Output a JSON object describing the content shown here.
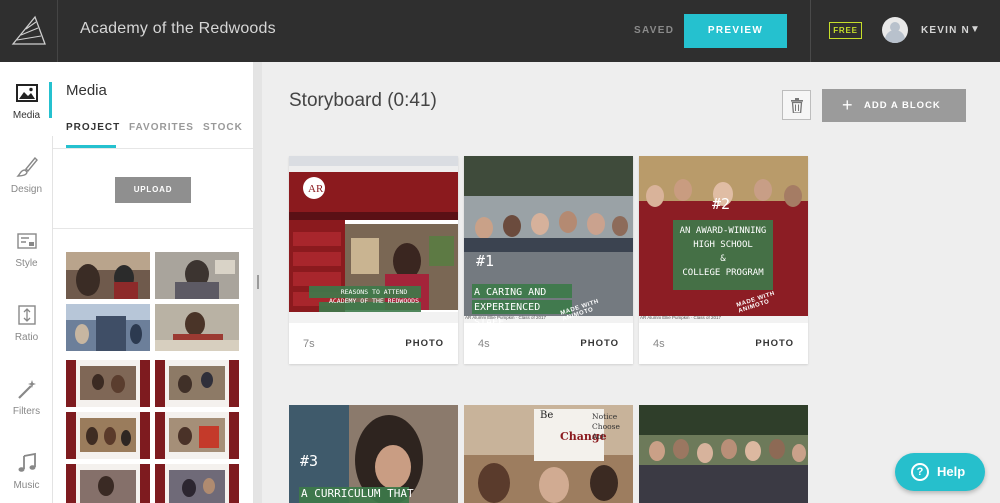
{
  "app": {
    "title": "Academy of the Redwoods",
    "status": "SAVED",
    "preview_label": "PREVIEW",
    "plan_badge": "FREE",
    "user_name": "KEVIN N",
    "accent": "#25c1cf"
  },
  "rail": {
    "items": [
      {
        "label": "Media",
        "icon": "image-icon",
        "active": true
      },
      {
        "label": "Design",
        "icon": "brush-icon"
      },
      {
        "label": "Style",
        "icon": "style-icon"
      },
      {
        "label": "Ratio",
        "icon": "ratio-icon"
      },
      {
        "label": "Filters",
        "icon": "magic-wand-icon"
      },
      {
        "label": "Music",
        "icon": "music-note-icon"
      }
    ]
  },
  "panel": {
    "title": "Media",
    "tabs": [
      {
        "label": "PROJECT",
        "active": true
      },
      {
        "label": "FAVORITES"
      },
      {
        "label": "STOCK"
      }
    ],
    "upload_label": "UPLOAD"
  },
  "storyboard": {
    "title": "Storyboard (0:41)",
    "add_block_label": "ADD A BLOCK",
    "cards": [
      {
        "duration": "7s",
        "kind": "PHOTO",
        "overlay": [
          "REASONS TO ATTEND",
          "ACADEMY OF THE REDWOODS"
        ],
        "caption": ""
      },
      {
        "duration": "4s",
        "kind": "PHOTO",
        "number": "#1",
        "overlay": [
          "A CARING AND",
          "EXPERIENCED STAFF"
        ],
        "watermark": "MADE WITH ANIMOTO",
        "caption": "AR Alumni Ellie Pumpkin · Class of 2017"
      },
      {
        "duration": "4s",
        "kind": "PHOTO",
        "number": "#2",
        "overlay": [
          "AN AWARD-WINNING",
          "HIGH SCHOOL",
          "&",
          "COLLEGE PROGRAM"
        ],
        "watermark": "MADE WITH ANIMOTO",
        "caption": "AR Alumni Ellie Pumpkin · Class of 2017"
      }
    ],
    "row2": [
      {
        "number": "#3",
        "overlay": "A CURRICULUM THAT"
      },
      {
        "sign": [
          "Notice",
          "Choose",
          "Act"
        ],
        "sign_head": "Be",
        "sign_big": "Change"
      },
      {}
    ]
  },
  "help_label": "Help"
}
